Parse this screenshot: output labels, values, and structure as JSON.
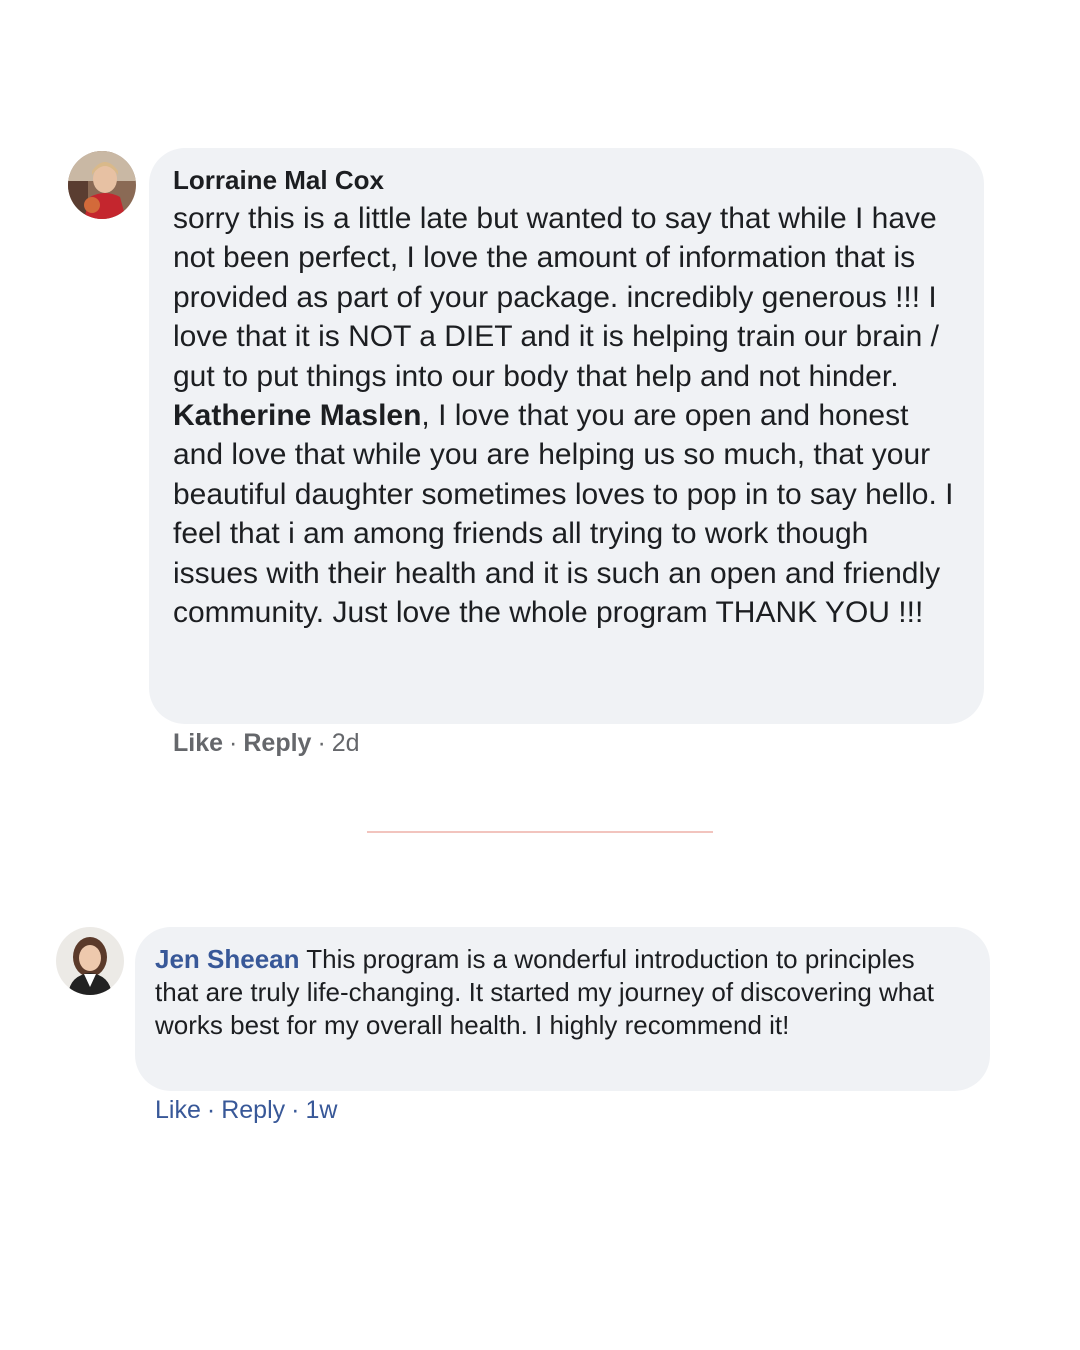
{
  "comments": [
    {
      "author": "Lorraine Mal Cox",
      "text_before_mention": "sorry this is a little late but wanted to say that while I have not been perfect, I love the amount of information that is provided as part of your package. incredibly generous !!! I love that it is NOT a DIET and it is helping train our brain / gut to put things into our body that help and not hinder. ",
      "mention": "Katherine Maslen",
      "text_after_mention": ", I love that you are open and honest and love that while you are helping us so much, that your beautiful daughter sometimes loves to pop in to say hello. I feel that i am among friends all trying to work though issues with their health and it is such an open and friendly community. Just love the whole program THANK YOU !!!",
      "like_label": "Like",
      "reply_label": "Reply",
      "separator": "·",
      "timestamp": "2d"
    },
    {
      "author": "Jen Sheean",
      "text": "This program is a wonderful introduction to principles that are truly life-changing. It started my journey of discovering what works best for my overall health. I highly recommend it!",
      "like_label": "Like",
      "reply_label": "Reply",
      "separator": "·",
      "timestamp": "1w"
    }
  ],
  "colors": {
    "bubble_background": "#f0f2f5",
    "text": "#1c1e21",
    "meta_grey": "#65676b",
    "link_blue": "#385898",
    "divider": "#f2c4be"
  }
}
